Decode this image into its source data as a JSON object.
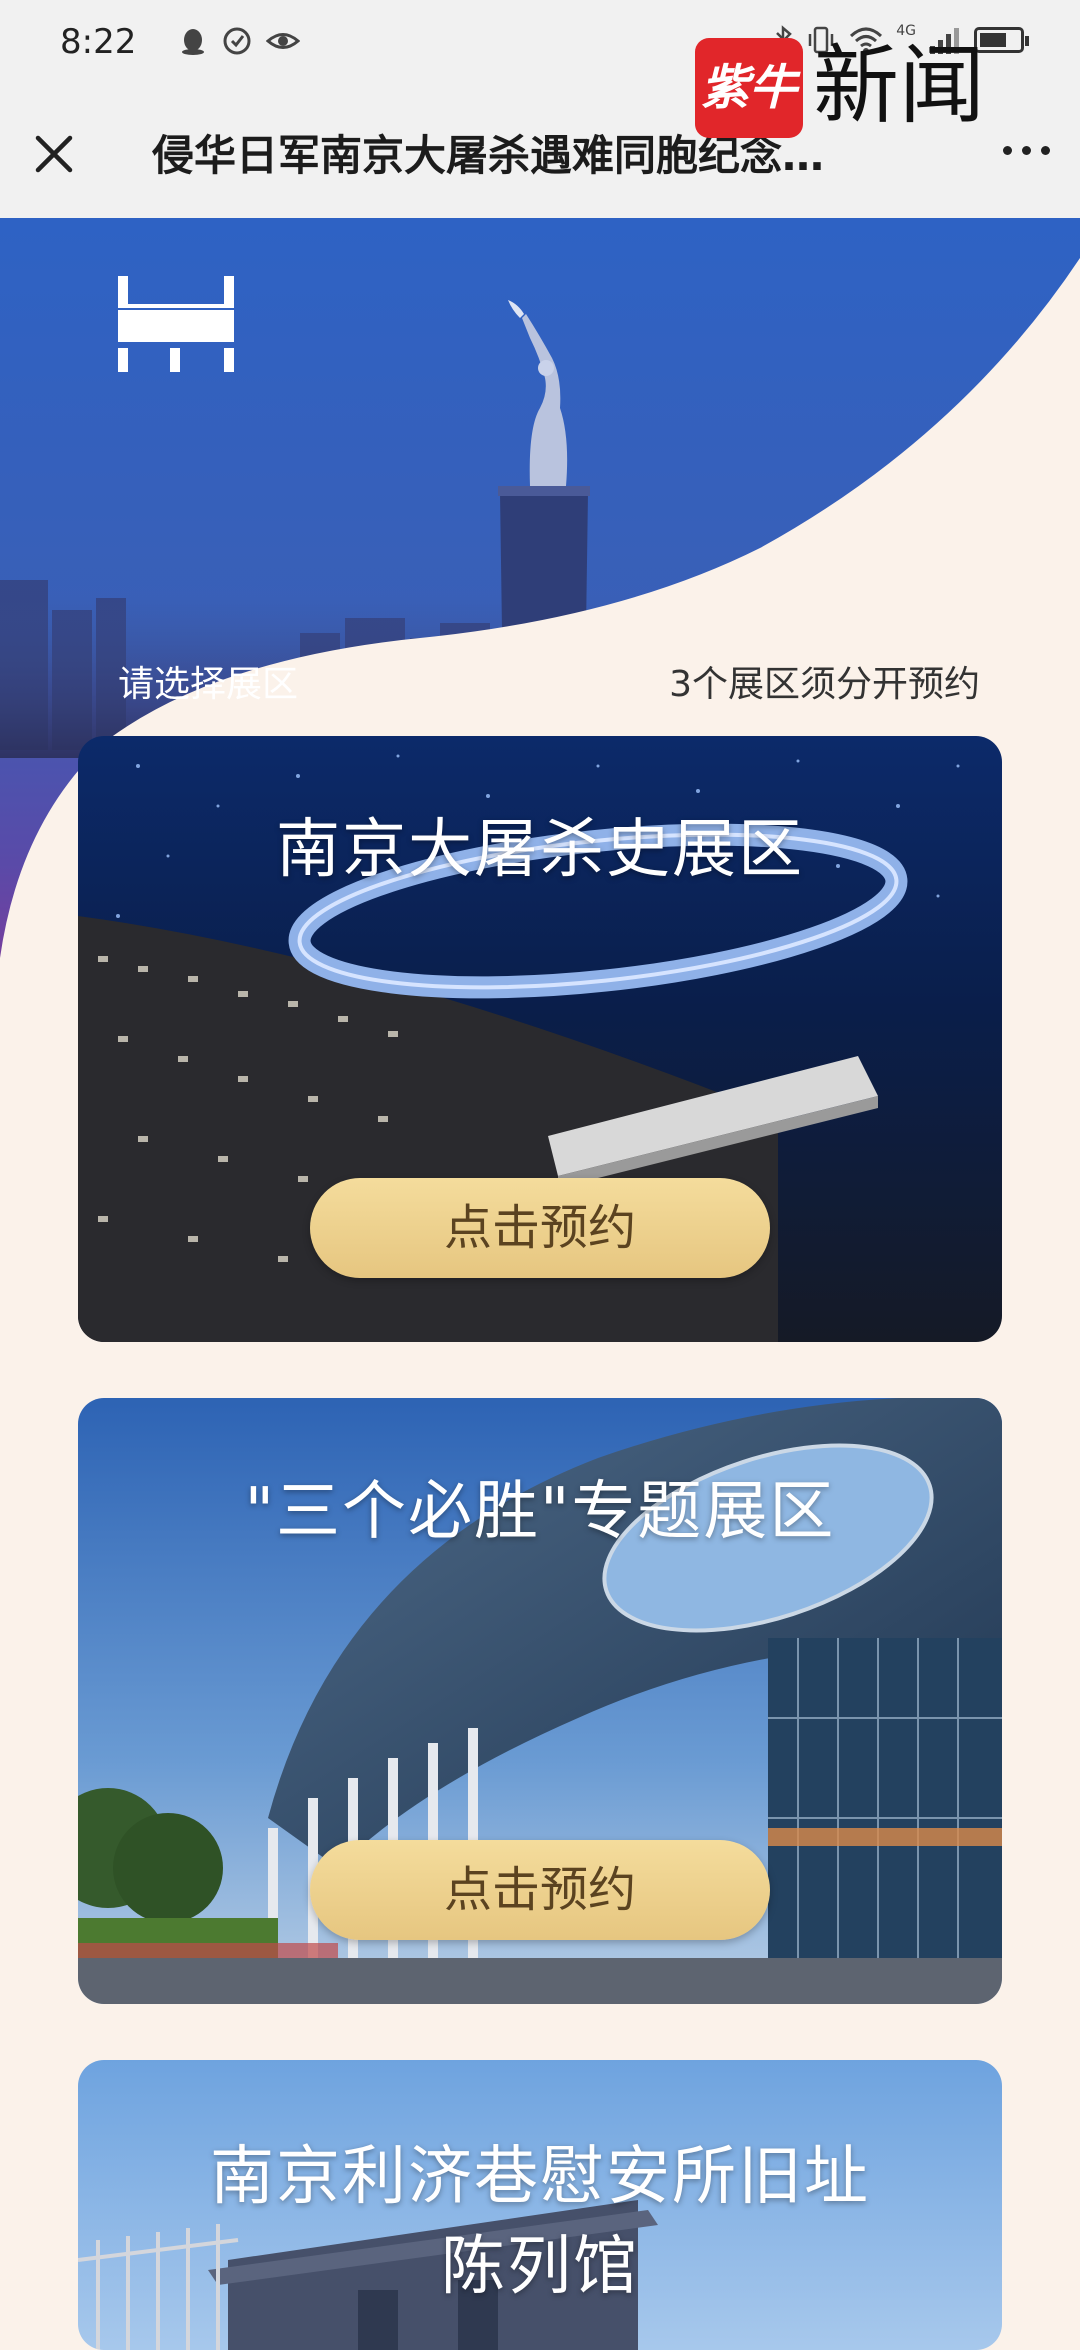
{
  "status_bar": {
    "time": "8:22",
    "network": "4G"
  },
  "nav": {
    "title": "侵华日军南京大屠杀遇难同胞纪念…"
  },
  "watermark": {
    "logo_text": "紫牛",
    "brand_text": "新闻"
  },
  "hero": {
    "left_label": "请选择展区",
    "right_label": "3个展区须分开预约"
  },
  "cards": [
    {
      "title": "南京大屠杀史展区",
      "button_label": "点击预约"
    },
    {
      "title": "\"三个必胜\"专题展区",
      "button_label": "点击预约"
    },
    {
      "title_line1": "南京利济巷慰安所旧址",
      "title_line2": "陈列馆"
    }
  ],
  "colors": {
    "page_bg": "#fbf2ea",
    "button_gold": "#efd290",
    "hero_blue": "#2f5fb8",
    "hero_purple": "#6a3a9a"
  }
}
